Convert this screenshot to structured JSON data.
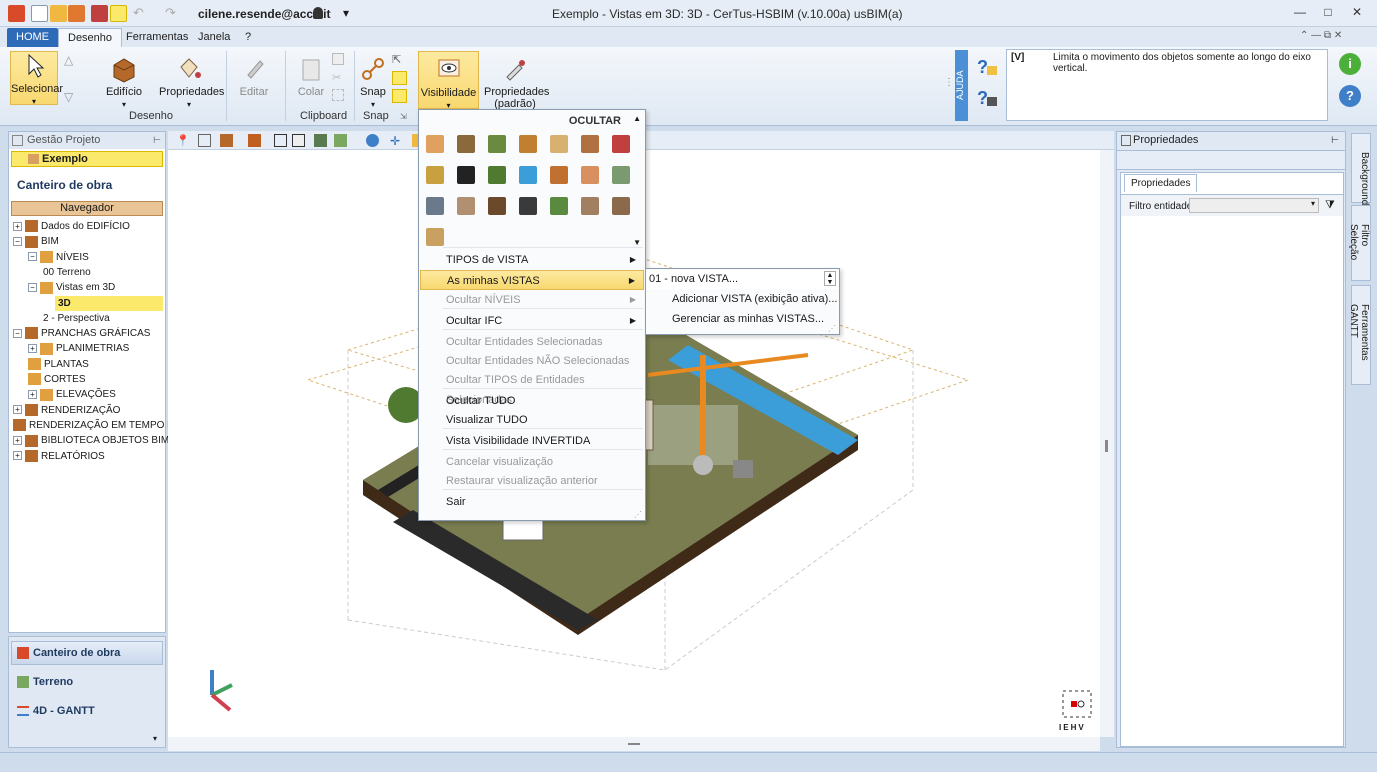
{
  "titlebar": {
    "user": "cilene.resende@acca.it",
    "title": "Exemplo -  Vistas em 3D: 3D - CerTus-HSBIM (v.10.00a) usBIM(a)",
    "minimize": "—",
    "restore": "□",
    "close": "✕"
  },
  "tabs": [
    "HOME",
    "Desenho",
    "Ferramentas",
    "Janela",
    "?"
  ],
  "ribbon": {
    "selecionar": "Selecionar",
    "edificio": "Edifício",
    "propriedades": "Propriedades",
    "editar": "Editar",
    "colar": "Colar",
    "snap": "Snap",
    "visibilidade": "Visibilidade",
    "propriedades_padrao_1": "Propriedades",
    "propriedades_padrao_2": "(padrão)",
    "groups": {
      "desenho": "Desenho",
      "clipboard": "Clipboard",
      "snap": "Snap"
    },
    "ajuda": "AJUDA",
    "help_code": "[V]",
    "help_text": "Limita o movimento dos objetos somente ao longo do eixo vertical."
  },
  "left_panel": {
    "header": "Gestão Projeto",
    "project": "Exemplo",
    "title": "Canteiro de obra",
    "navigator": "Navegador",
    "tree": [
      {
        "label": "Dados do EDIFÍCIO",
        "level": 0,
        "exp": "+"
      },
      {
        "label": "BIM",
        "level": 0,
        "exp": "−"
      },
      {
        "label": "NÍVEIS",
        "level": 1,
        "exp": "−"
      },
      {
        "label": "00 Terreno",
        "level": 2,
        "exp": ""
      },
      {
        "label": "Vistas em 3D",
        "level": 1,
        "exp": "−"
      },
      {
        "label": "3D",
        "level": 2,
        "exp": "",
        "selected": true
      },
      {
        "label": "2 - Perspectiva",
        "level": 2,
        "exp": ""
      },
      {
        "label": "PRANCHAS GRÁFICAS",
        "level": 0,
        "exp": "−"
      },
      {
        "label": "PLANIMETRIAS",
        "level": 1,
        "exp": "+"
      },
      {
        "label": "PLANTAS",
        "level": 1,
        "exp": ""
      },
      {
        "label": "CORTES",
        "level": 1,
        "exp": ""
      },
      {
        "label": "ELEVAÇÕES",
        "level": 1,
        "exp": "+"
      },
      {
        "label": "RENDERIZAÇÃO",
        "level": 0,
        "exp": "+"
      },
      {
        "label": "RENDERIZAÇÃO EM TEMPO RE...",
        "level": 0,
        "exp": ""
      },
      {
        "label": "BIBLIOTECA  OBJETOS BIM",
        "level": 0,
        "exp": "+"
      },
      {
        "label": "RELATÓRIOS",
        "level": 0,
        "exp": "+"
      }
    ],
    "bottom": [
      "Canteiro de obra",
      "Terreno",
      "4D - GANTT"
    ]
  },
  "dropdown": {
    "header": "OCULTAR",
    "items": [
      {
        "label": "TIPOS de VISTA",
        "disabled": false,
        "arrow": true
      },
      {
        "label": "As minhas VISTAS",
        "disabled": false,
        "arrow": true,
        "highlight": true
      },
      {
        "label": "Ocultar NÍVEIS",
        "disabled": true,
        "arrow": true
      },
      {
        "label": "Ocultar IFC",
        "disabled": false,
        "arrow": true
      },
      {
        "label": "Ocultar Entidades Selecionadas",
        "disabled": true,
        "arrow": false
      },
      {
        "label": "Ocultar Entidades NÃO Selecionadas",
        "disabled": true,
        "arrow": false
      },
      {
        "label": "Ocultar TIPOS de Entidades Selecionadas",
        "disabled": true,
        "arrow": false
      },
      {
        "label": "Ocultar TUDO",
        "disabled": false,
        "arrow": false
      },
      {
        "label": "Visualizar TUDO",
        "disabled": false,
        "arrow": false
      },
      {
        "label": "Vista Visibilidade INVERTIDA",
        "disabled": false,
        "arrow": false
      },
      {
        "label": "Cancelar visualização",
        "disabled": true,
        "arrow": false
      },
      {
        "label": "Restaurar visualização anterior",
        "disabled": true,
        "arrow": false
      },
      {
        "label": "Sair",
        "disabled": false,
        "arrow": false
      }
    ]
  },
  "submenu": {
    "select_value": "01 - nova VISTA...",
    "items": [
      "Adicionar VISTA (exibição ativa)...",
      "Gerenciar as minhas VISTAS..."
    ]
  },
  "right_panel": {
    "header": "Propriedades",
    "tab": "Propriedades",
    "filter_label": "Filtro entidade",
    "side_tabs": [
      "Background",
      "Filtro Seleção",
      "Ferramentas GANTT"
    ]
  },
  "viewcube": [
    "I",
    "E",
    "H",
    "V"
  ],
  "colors": {
    "accent": "#2d6ab8",
    "highlight": "#fbe96c",
    "navigator": "#e8c496"
  }
}
